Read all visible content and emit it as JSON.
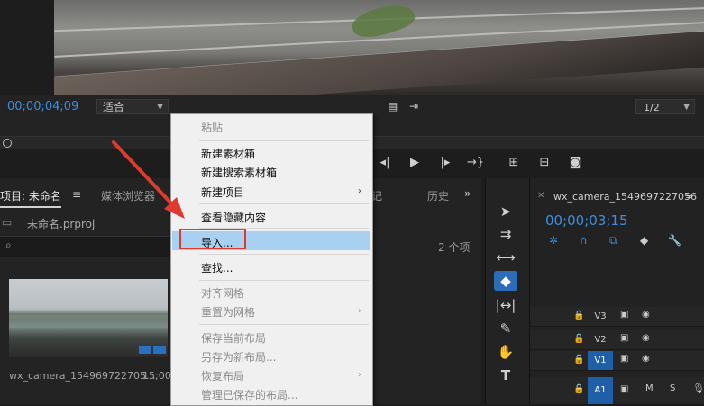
{
  "monitor": {
    "timecode": "00;00;04;09",
    "fit_label": "适合",
    "resolution": "1/2"
  },
  "project_panel": {
    "tab_project": "项目: 未命名",
    "tab_media_browser": "媒体浏览器",
    "file_name": "未命名.prproj",
    "item_count": "2 个项",
    "clip_name": "wx_camera_154969722705...",
    "clip_duration": "15;00"
  },
  "hidden_tabs": {
    "markers_partial": "记",
    "history_partial": "历史",
    "more": "»"
  },
  "context_menu": {
    "items": [
      {
        "label": "粘贴",
        "disabled": true
      },
      {
        "label": "新建素材箱",
        "disabled": false
      },
      {
        "label": "新建搜索素材箱",
        "disabled": false
      },
      {
        "label": "新建项目",
        "disabled": false,
        "submenu": true
      },
      {
        "label": "查看隐藏内容",
        "disabled": false
      },
      {
        "label": "导入...",
        "disabled": false,
        "highlighted": true
      },
      {
        "label": "查找...",
        "disabled": false
      },
      {
        "label": "对齐网格",
        "disabled": true
      },
      {
        "label": "重置为网格",
        "disabled": true,
        "submenu": true
      },
      {
        "label": "保存当前布局",
        "disabled": true
      },
      {
        "label": "另存为新布局...",
        "disabled": true
      },
      {
        "label": "恢复布局",
        "disabled": true,
        "submenu": true
      },
      {
        "label": "管理已保存的布局...",
        "disabled": true
      }
    ]
  },
  "timeline": {
    "sequence_name": "wx_camera_1549697227056",
    "timecode": "00;00;03;15",
    "tracks": [
      {
        "name": "V3",
        "active": false
      },
      {
        "name": "V2",
        "active": false
      },
      {
        "name": "V1",
        "active": true
      },
      {
        "name": "A1",
        "active": true,
        "m": "M",
        "s": "S"
      }
    ]
  },
  "colors": {
    "accent_blue": "#3c8fe0",
    "highlight": "#a8d0f0",
    "annotation_red": "#e03a2f"
  }
}
